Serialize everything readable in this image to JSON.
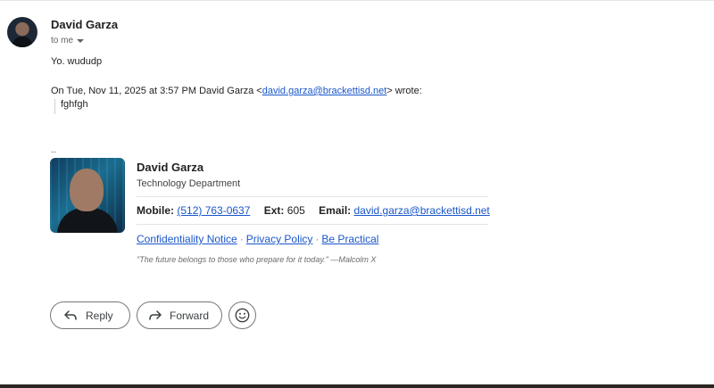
{
  "email": {
    "sender_name": "David Garza",
    "recipient_label": "to me",
    "body": "Yo. wududp",
    "quote_header_prefix": "On Tue, Nov 11, 2025 at 3:57 PM David Garza <",
    "quote_header_email": "david.garza@brackettisd.net",
    "quote_header_suffix": "> wrote:",
    "quoted_text": "fghfgh"
  },
  "signature": {
    "dash": "--",
    "name": "David Garza",
    "department": "Technology Department",
    "mobile_label": "Mobile:",
    "mobile_value": "(512) 763-0637",
    "ext_label": "Ext:",
    "ext_value": "605",
    "email_label": "Email:",
    "email_value": "david.garza@brackettisd.net",
    "links": [
      "Confidentiality Notice",
      "Privacy Policy",
      "Be Practical"
    ],
    "link_separator": "·",
    "quote": "\"The future belongs to those who prepare for it today.\" —Malcolm X"
  },
  "actions": {
    "reply_label": "Reply",
    "forward_label": "Forward"
  },
  "icons": {
    "reply": "reply-arrow-icon",
    "forward": "forward-arrow-icon",
    "emoji": "smiley-face-icon",
    "caret": "chevron-down-icon"
  }
}
